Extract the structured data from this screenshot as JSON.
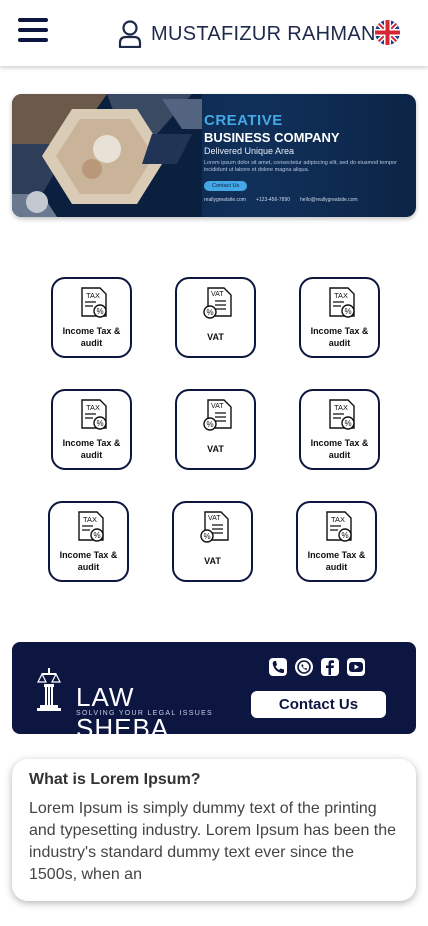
{
  "header": {
    "user_name": "MUSTAFIZUR RAHMAN"
  },
  "banner": {
    "title_line1": "CREATIVE",
    "title_line2": "BUSINESS COMPANY",
    "tagline": "Delivered Unique Area",
    "body": "Lorem ipsum dolor sit amet, consectetur adipiscing elit, sed do eiusmod tempor incididunt ut labore et dolore magna aliqua.",
    "contact_label": "Contact Us",
    "website": "reallygreatsite.com",
    "phone": "+123-456-7890",
    "email": "hello@reallygreatsite.com"
  },
  "services": [
    {
      "label": "Income Tax & audit",
      "icon": "tax-document-icon"
    },
    {
      "label": "VAT",
      "icon": "vat-document-icon"
    },
    {
      "label": "Income Tax & audit",
      "icon": "tax-document-icon"
    },
    {
      "label": "Income Tax & audit",
      "icon": "tax-document-icon"
    },
    {
      "label": "VAT",
      "icon": "vat-document-icon"
    },
    {
      "label": "Income Tax & audit",
      "icon": "tax-document-icon"
    },
    {
      "label": "Income Tax & audit",
      "icon": "tax-document-icon"
    },
    {
      "label": "VAT",
      "icon": "vat-document-icon"
    },
    {
      "label": "Income Tax & audit",
      "icon": "tax-document-icon"
    }
  ],
  "footer": {
    "logo_text": "LAW SHEBA",
    "logo_tagline": "SOLVING YOUR LEGAL ISSUES",
    "contact_button": "Contact Us",
    "social_icons": [
      "phone-icon",
      "whatsapp-icon",
      "facebook-icon",
      "youtube-icon"
    ]
  },
  "info": {
    "title": "What is Lorem Ipsum?",
    "body": "Lorem Ipsum is simply dummy text of the printing and typesetting industry. Lorem Ipsum has been the industry's standard dummy text ever since the 1500s, when an"
  },
  "colors": {
    "navy": "#0d1640",
    "banner_accent": "#45a8e6"
  }
}
